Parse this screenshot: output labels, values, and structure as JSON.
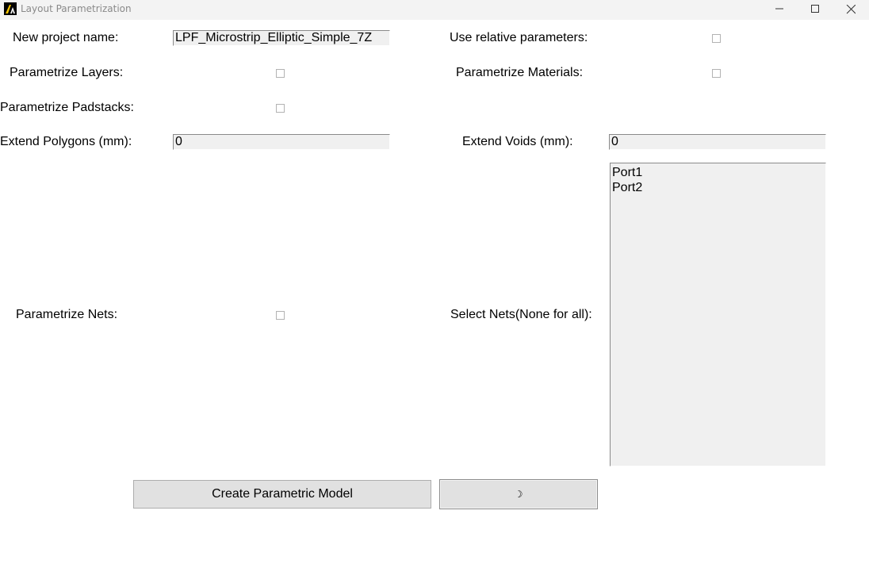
{
  "window": {
    "title": "Layout Parametrization"
  },
  "form": {
    "project_name_label": "New project name:",
    "project_name_value": "LPF_Microstrip_Elliptic_Simple_7Z",
    "relative_params_label": "Use relative parameters:",
    "relative_params_checked": false,
    "layers_label": "Parametrize Layers:",
    "layers_checked": false,
    "materials_label": "Parametrize Materials:",
    "materials_checked": false,
    "padstacks_label": "Parametrize Padstacks:",
    "padstacks_checked": false,
    "extend_polygons_label": "Extend Polygons (mm):",
    "extend_polygons_value": "0",
    "extend_voids_label": "Extend Voids (mm):",
    "extend_voids_value": "0",
    "nets_label": "Parametrize Nets:",
    "nets_checked": false,
    "select_nets_label": "Select Nets(None for all):",
    "nets_list": [
      "Port1",
      "Port2"
    ]
  },
  "buttons": {
    "create_label": "Create Parametric Model",
    "second_button_glyph": "☽"
  },
  "icons": {
    "app": "ansys-logo-icon",
    "minimize": "minimize-icon",
    "maximize": "maximize-icon",
    "close": "close-icon"
  }
}
